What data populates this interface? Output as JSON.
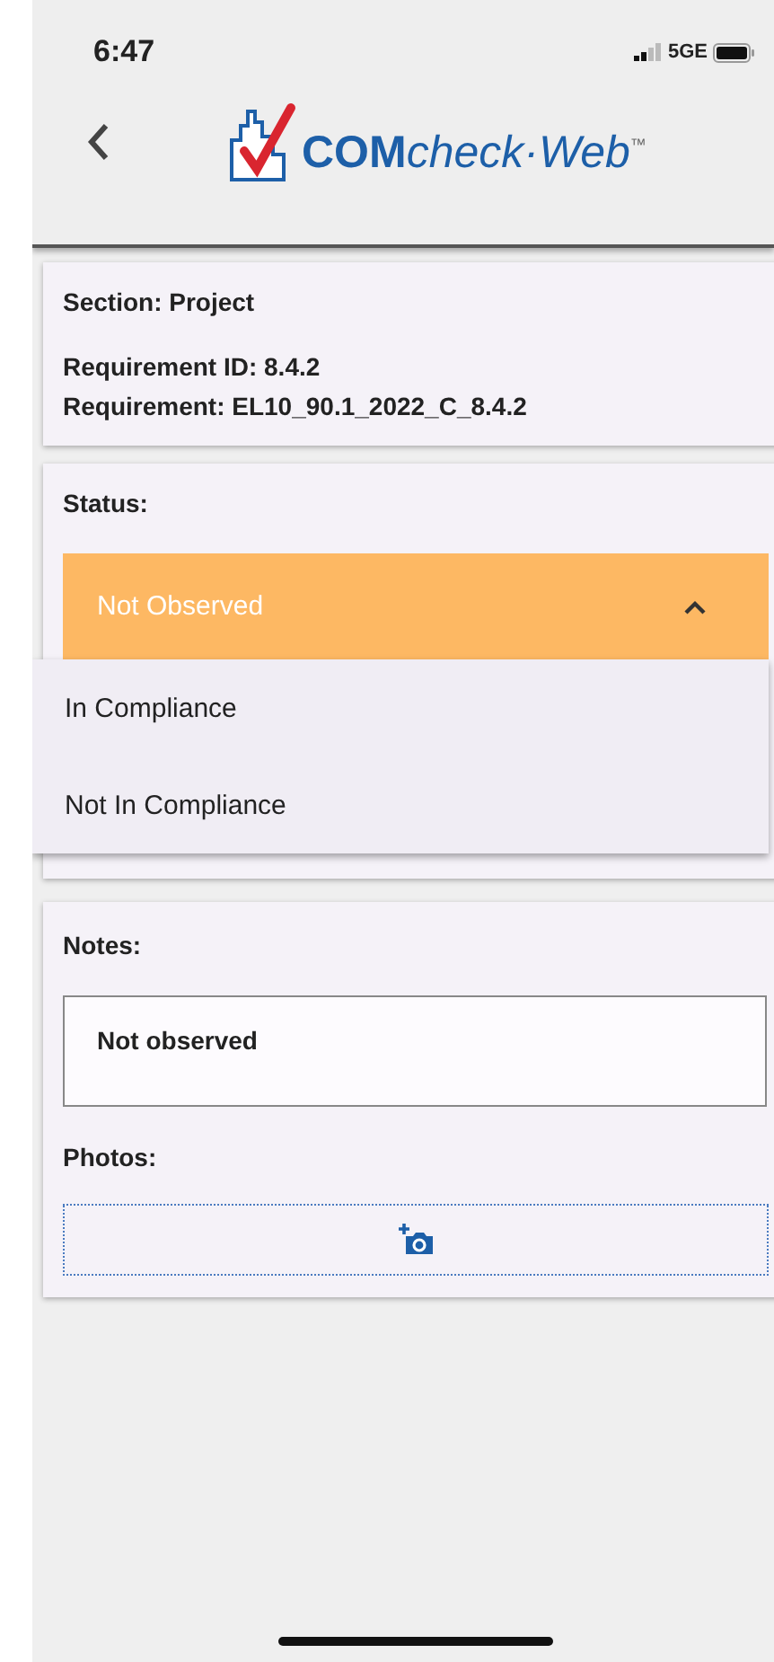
{
  "status_bar": {
    "time": "6:47",
    "network": "5GE"
  },
  "header": {
    "logo_bold": "COM",
    "logo_italic": "check·Web",
    "trademark": "™"
  },
  "info_card": {
    "section": "Section: Project",
    "requirement_id": "Requirement ID: 8.4.2",
    "requirement": "Requirement: EL10_90.1_2022_C_8.4.2"
  },
  "status_card": {
    "label": "Status:",
    "value": "Not Observed",
    "expanded": true,
    "options": [
      {
        "label": "In Compliance",
        "selected": false
      },
      {
        "label": "Not In Compliance",
        "selected": false
      }
    ]
  },
  "notes_card": {
    "notes_label": "Notes:",
    "notes_value": "Not observed",
    "photos_label": "Photos:"
  }
}
